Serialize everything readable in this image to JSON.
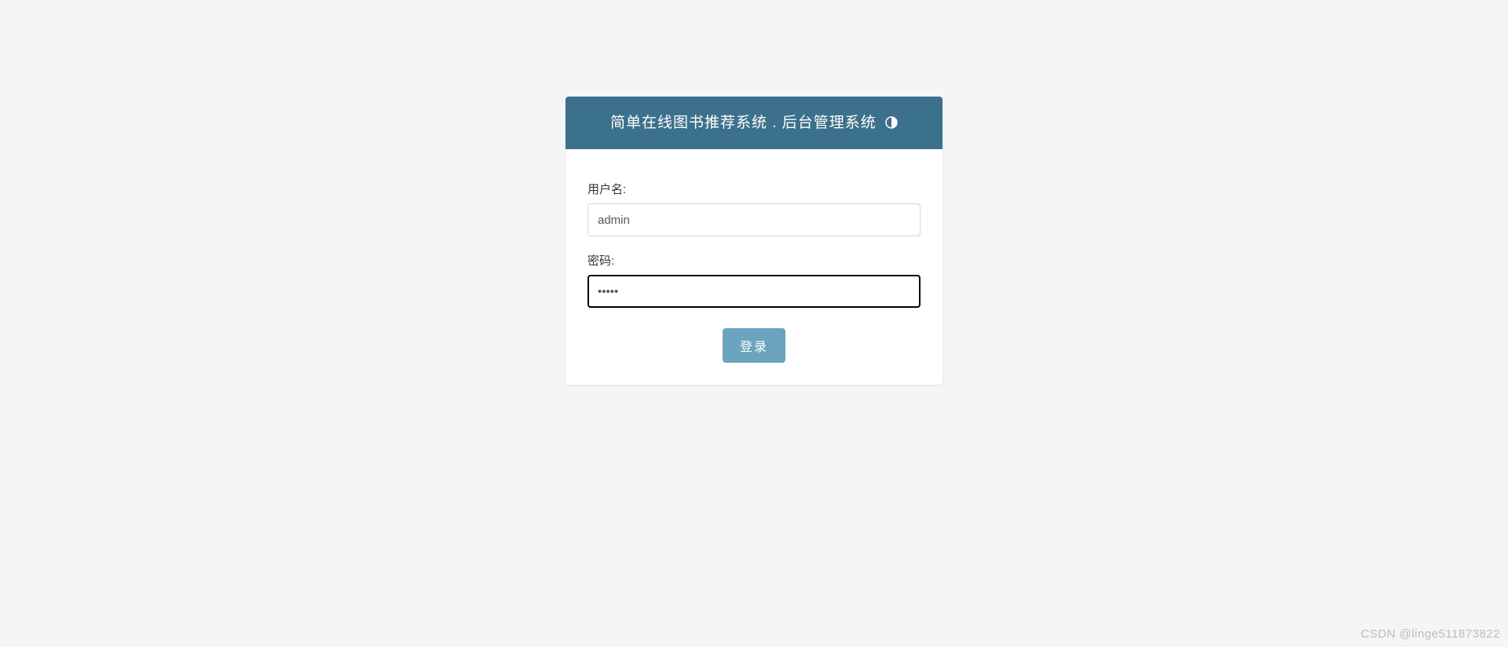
{
  "panel": {
    "title": "简单在线图书推荐系统 . 后台管理系统"
  },
  "form": {
    "username_label": "用户名:",
    "username_value": "admin",
    "password_label": "密码:",
    "password_value": "•••••",
    "login_button": "登录"
  },
  "watermark": "CSDN @linge511873822"
}
